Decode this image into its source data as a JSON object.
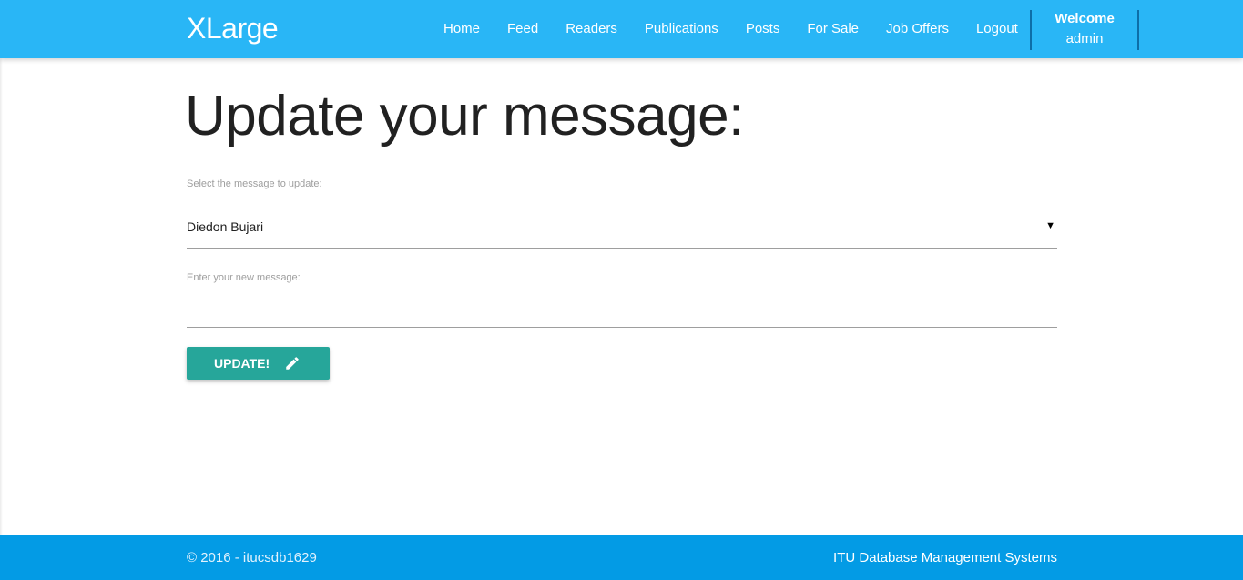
{
  "navbar": {
    "brand": "XLarge",
    "links": [
      {
        "label": "Home"
      },
      {
        "label": "Feed"
      },
      {
        "label": "Readers"
      },
      {
        "label": "Publications"
      },
      {
        "label": "Posts"
      },
      {
        "label": "For Sale"
      },
      {
        "label": "Job Offers"
      },
      {
        "label": "Logout"
      }
    ],
    "welcome": {
      "line1": "Welcome",
      "line2": "admin"
    }
  },
  "main": {
    "title": "Update your message:",
    "select_label": "Select the message to update:",
    "select_value": "Diedon Bujari",
    "message_label": "Enter your new message:",
    "message_value": "",
    "update_button": "UPDATE!"
  },
  "footer": {
    "copyright": "© 2016 - itucsdb1629",
    "right_text": "ITU Database Management Systems"
  },
  "colors": {
    "navbar": "#29b6f6",
    "footer": "#039be5",
    "button": "#26a69a"
  },
  "icons": {
    "dropdown": "caret-down-icon",
    "button": "pencil-icon"
  }
}
